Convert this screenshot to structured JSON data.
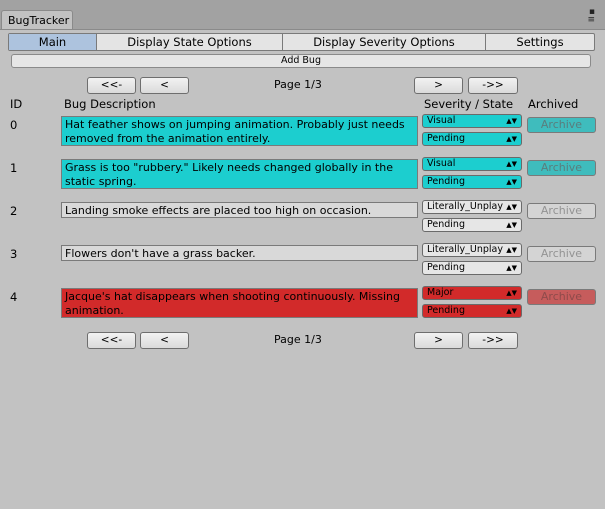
{
  "window": {
    "tab_title": "BugTracker",
    "menu_glyph": "▪",
    "menu_lines": "≡"
  },
  "toolbar": {
    "tabs": [
      {
        "label": "Main",
        "active": true
      },
      {
        "label": "Display State Options",
        "active": false
      },
      {
        "label": "Display Severity Options",
        "active": false
      },
      {
        "label": "Settings",
        "active": false
      }
    ]
  },
  "add_bug_label": "Add Bug",
  "pager": {
    "first": "<<-",
    "prev": "<",
    "next": ">",
    "last": "->>",
    "label": "Page 1/3"
  },
  "headers": {
    "id": "ID",
    "description": "Bug Description",
    "severity_state": "Severity / State",
    "archived": "Archived"
  },
  "archive_label": "Archive",
  "colors": {
    "cyan": "#1ccecf",
    "red": "#d22a2a",
    "grey": "#d9d9d9"
  },
  "bugs": [
    {
      "id": "0",
      "description": "Hat feather shows on jumping animation. Probably just needs removed from the animation entirely.",
      "severity": "Visual",
      "state": "Pending",
      "color": "cyan"
    },
    {
      "id": "1",
      "description": "Grass is too \"rubbery.\" Likely needs changed globally in the static spring.",
      "severity": "Visual",
      "state": "Pending",
      "color": "cyan"
    },
    {
      "id": "2",
      "description": "Landing smoke effects are placed too high on occasion.",
      "severity": "Literally_Unplay",
      "state": "Pending",
      "color": "grey"
    },
    {
      "id": "3",
      "description": "Flowers don't have a grass backer.",
      "severity": "Literally_Unplay",
      "state": "Pending",
      "color": "grey"
    },
    {
      "id": "4",
      "description": "Jacque's hat disappears when shooting continuously. Missing animation.",
      "severity": "Major",
      "state": "Pending",
      "color": "red"
    }
  ]
}
